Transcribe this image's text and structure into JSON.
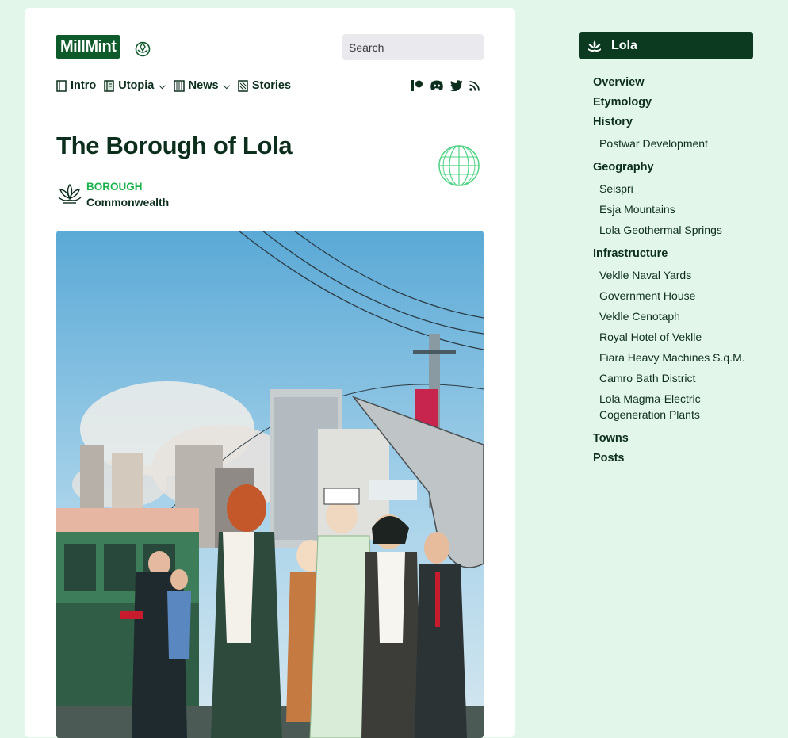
{
  "brand": {
    "logo_text": "MillMint",
    "accent": "#0f5a2a",
    "highlight": "#1bb24e"
  },
  "search": {
    "placeholder": "Search"
  },
  "nav": [
    {
      "label": "Intro",
      "icon": "book-icon"
    },
    {
      "label": "Utopia",
      "icon": "book-icon",
      "has_dropdown": true
    },
    {
      "label": "News",
      "icon": "newspaper-icon",
      "has_dropdown": true
    },
    {
      "label": "Stories",
      "icon": "book-icon"
    }
  ],
  "social": [
    "patreon-icon",
    "discord-icon",
    "twitter-icon",
    "rss-icon"
  ],
  "page": {
    "title": "The Borough of Lola",
    "category_type": "BOROUGH",
    "category_name": "Commonwealth"
  },
  "sidebar": {
    "header": "Lola",
    "sections": [
      {
        "label": "Overview",
        "items": []
      },
      {
        "label": "Etymology",
        "items": []
      },
      {
        "label": "History",
        "items": [
          "Postwar Development"
        ]
      },
      {
        "label": "Geography",
        "items": [
          "Seispri",
          "Esja Mountains",
          "Lola Geothermal Springs"
        ]
      },
      {
        "label": "Infrastructure",
        "items": [
          "Veklle Naval Yards",
          "Government House",
          "Veklle Cenotaph",
          "Royal Hotel of Veklle",
          "Fiara Heavy Machines S.q.M.",
          "Camro Bath District",
          "Lola Magma-Electric Cogeneration Plants"
        ]
      },
      {
        "label": "Towns",
        "items": []
      },
      {
        "label": "Posts",
        "items": []
      }
    ]
  }
}
